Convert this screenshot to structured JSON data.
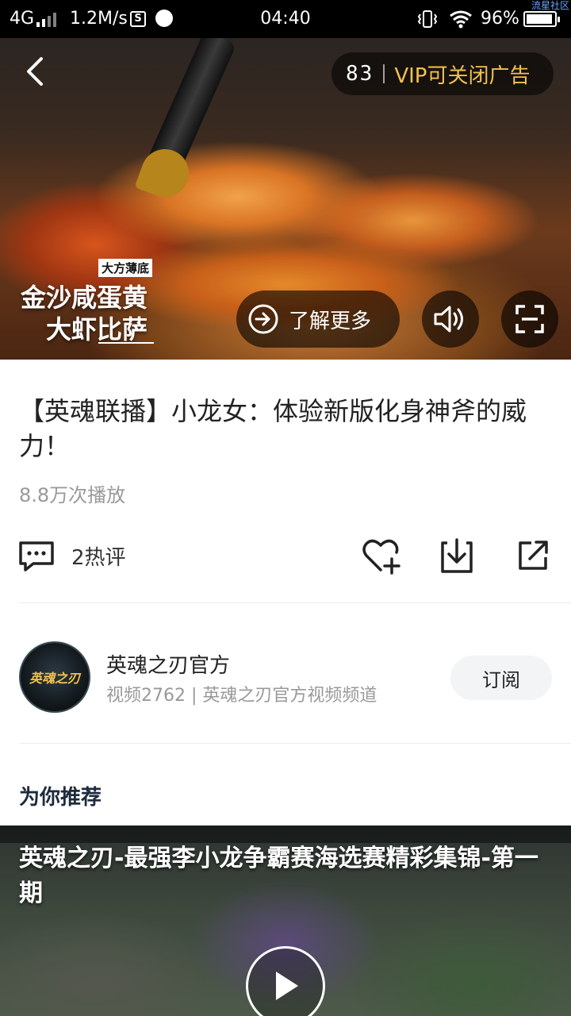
{
  "status_bar": {
    "network": "4G",
    "speed": "1.2M/s",
    "s_badge": "S",
    "time": "04:40",
    "battery": "96%",
    "watermark": "流星社区"
  },
  "ad": {
    "countdown": "83",
    "vip_close": "VIP可关闭广告",
    "brand_tag": "大方薄底",
    "brand_line1": "金沙咸蛋黄",
    "brand_line2": "大虾比萨",
    "learn_more": "了解更多"
  },
  "video": {
    "title": "【英魂联播】小龙女：体验新版化身神斧的威力！",
    "play_count": "8.8万次播放"
  },
  "actions": {
    "comments": "2热评"
  },
  "channel": {
    "avatar_text": "英魂之刃",
    "name": "英魂之刃官方",
    "meta": "视频2762 | 英魂之刃官方视频频道",
    "subscribe": "订阅"
  },
  "recommend": {
    "heading": "为你推荐",
    "items": [
      {
        "title": "英魂之刃-最强李小龙争霸赛海选赛精彩集锦-第一期"
      }
    ]
  },
  "colors": {
    "accent_gold": "#f2c14e",
    "heading": "#1e2b3c",
    "muted": "#999999"
  }
}
